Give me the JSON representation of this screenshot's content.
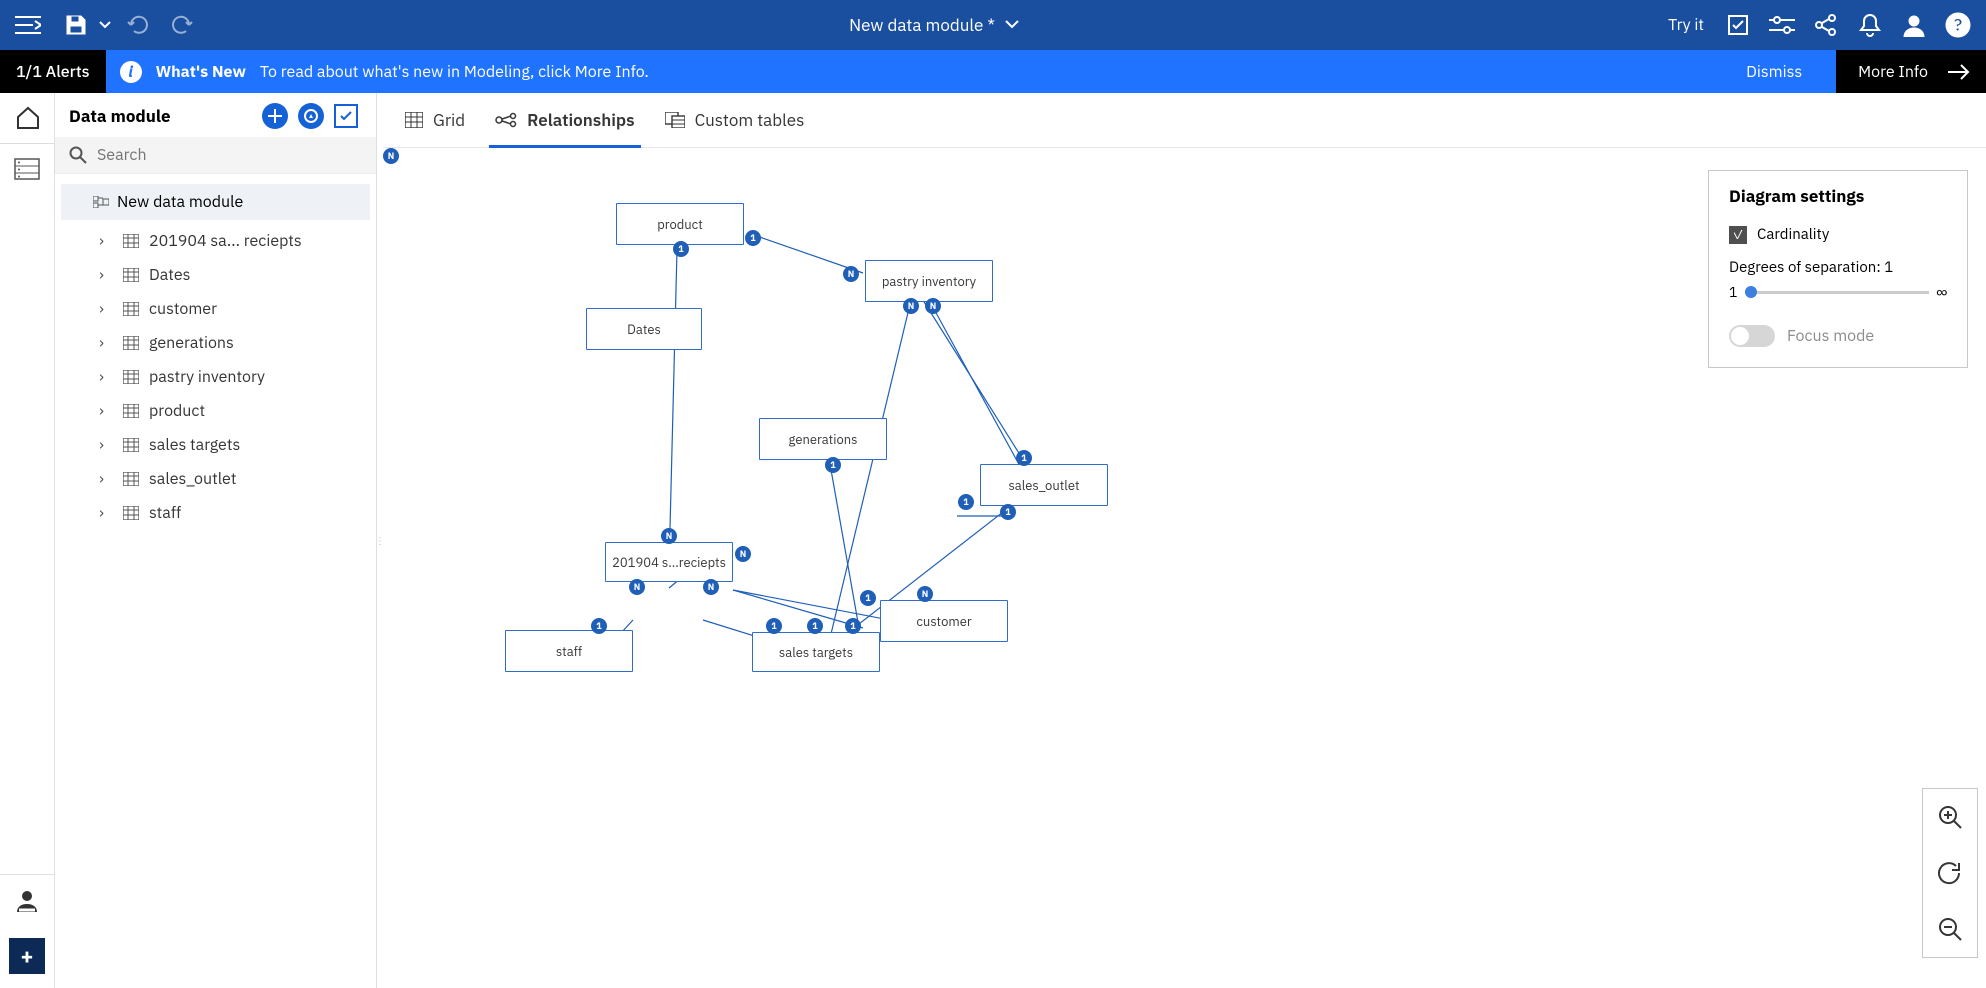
{
  "header": {
    "title": "New data module *",
    "try_it": "Try it"
  },
  "alert": {
    "count": "1/1 Alerts",
    "heading": "What's New",
    "body": "To read about what's new in Modeling, click More Info.",
    "dismiss": "Dismiss",
    "more": "More Info"
  },
  "side": {
    "title": "Data module",
    "search_placeholder": "Search",
    "root": "New data module",
    "items": [
      "201904 sa... reciepts",
      "Dates",
      "customer",
      "generations",
      "pastry inventory",
      "product",
      "sales targets",
      "sales_outlet",
      "staff"
    ]
  },
  "tabs": {
    "grid": "Grid",
    "relationships": "Relationships",
    "custom": "Custom tables"
  },
  "diagram_settings": {
    "title": "Diagram settings",
    "cardinality": "Cardinality",
    "degrees_label": "Degrees of separation: 1",
    "slider_min": "1",
    "slider_max": "∞",
    "focus_mode": "Focus mode"
  },
  "nodes": {
    "product": "product",
    "dates": "Dates",
    "pastry": "pastry inventory",
    "generations": "generations",
    "sales_outlet": "sales_outlet",
    "reciepts": "201904 s...reciepts",
    "customer": "customer",
    "sales_targets": "sales targets",
    "staff": "staff"
  }
}
